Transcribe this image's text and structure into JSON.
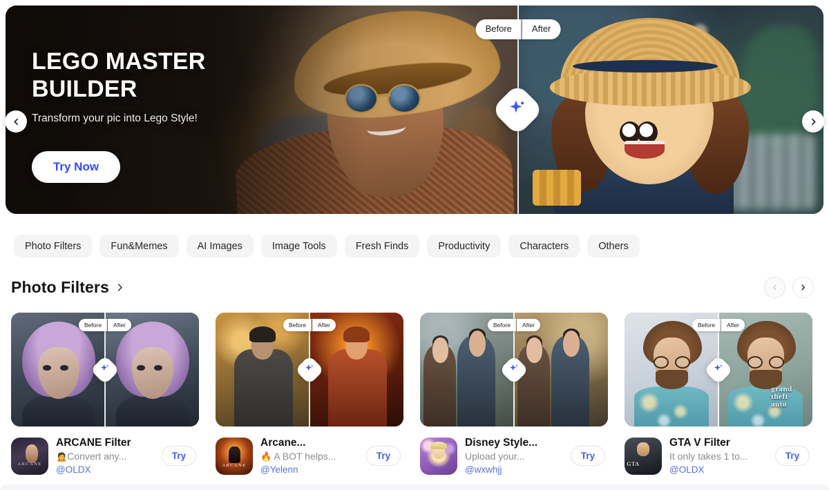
{
  "hero": {
    "title": "LEGO MASTER BUILDER",
    "subtitle": "Transform your pic into Lego Style!",
    "cta_label": "Try Now",
    "before_label": "Before",
    "after_label": "After",
    "prev_label": "‹",
    "next_label": "›",
    "cta_text_color": "#2f4cf5"
  },
  "categories": [
    {
      "label": "Photo Filters"
    },
    {
      "label": "Fun&Memes"
    },
    {
      "label": "AI Images"
    },
    {
      "label": "Image Tools"
    },
    {
      "label": "Fresh Finds"
    },
    {
      "label": "Productivity"
    },
    {
      "label": "Characters"
    },
    {
      "label": "Others"
    }
  ],
  "section": {
    "title": "Photo Filters",
    "chevron": "›",
    "pager_prev": "‹",
    "pager_next": "›"
  },
  "labels": {
    "before": "Before",
    "after": "After",
    "try": "Try"
  },
  "cards": [
    {
      "title": "ARCANE Filter",
      "desc_emoji": "🙍",
      "desc": "Convert any...",
      "user": "@OLDX",
      "try_label": "Try"
    },
    {
      "title": "Arcane...",
      "desc_emoji": "🔥",
      "desc": "A BOT helps...",
      "user": "@Yelenn",
      "try_label": "Try"
    },
    {
      "title": "Disney Style...",
      "desc_emoji": "",
      "desc": "Upload your...",
      "user": "@wxwhjj",
      "try_label": "Try"
    },
    {
      "title": "GTA V Filter",
      "desc_emoji": "",
      "desc": "It only takes 1 to...",
      "user": "@OLDX",
      "try_label": "Try"
    }
  ],
  "gta_overlay": {
    "line1": "grand",
    "line2": "theft",
    "line3": "auto"
  },
  "colors": {
    "accent_blue": "#3f62f0",
    "user_blue": "#5a6fe0",
    "chip_bg": "#f4f4f5",
    "page_bg": "#ffffff"
  }
}
